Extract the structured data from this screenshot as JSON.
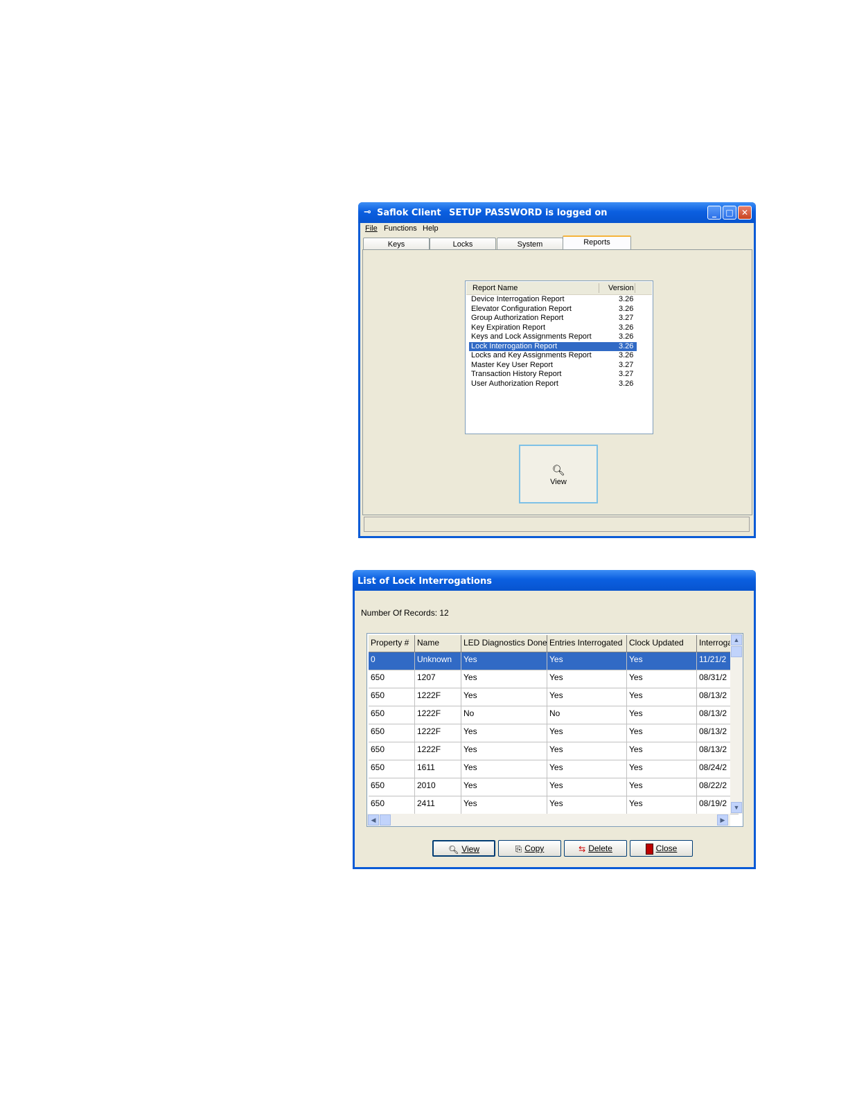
{
  "main_window": {
    "app_title": "Saflok Client",
    "login_status": "SETUP PASSWORD is logged on",
    "menu": [
      "File",
      "Functions",
      "Help"
    ],
    "tabs": [
      "Keys",
      "Locks",
      "System",
      "Reports"
    ],
    "active_tab": "Reports",
    "report_list": {
      "columns": [
        "Report Name",
        "Version"
      ],
      "rows": [
        {
          "name": "Device Interrogation Report",
          "version": "3.26"
        },
        {
          "name": "Elevator Configuration Report",
          "version": "3.26"
        },
        {
          "name": "Group Authorization Report",
          "version": "3.27"
        },
        {
          "name": "Key Expiration Report",
          "version": "3.26"
        },
        {
          "name": "Keys and Lock Assignments Report",
          "version": "3.26"
        },
        {
          "name": "Lock Interrogation Report",
          "version": "3.26",
          "selected": true
        },
        {
          "name": "Locks and Key Assignments Report",
          "version": "3.26"
        },
        {
          "name": "Master Key User Report",
          "version": "3.27"
        },
        {
          "name": "Transaction History Report",
          "version": "3.27"
        },
        {
          "name": "User Authorization Report",
          "version": "3.26"
        }
      ]
    },
    "view_button": "View"
  },
  "dialog": {
    "title": "List of Lock Interrogations",
    "record_count": "Number Of Records: 12",
    "columns": [
      "Property #",
      "Name",
      "LED Diagnostics Done",
      "Entries Interrogated",
      "Clock Updated",
      "Interroga"
    ],
    "rows": [
      [
        "0",
        "Unknown",
        "Yes",
        "Yes",
        "Yes",
        "11/21/2"
      ],
      [
        "650",
        "1207",
        "Yes",
        "Yes",
        "Yes",
        "08/31/2"
      ],
      [
        "650",
        "1222F",
        "Yes",
        "Yes",
        "Yes",
        "08/13/2"
      ],
      [
        "650",
        "1222F",
        "No",
        "No",
        "Yes",
        "08/13/2"
      ],
      [
        "650",
        "1222F",
        "Yes",
        "Yes",
        "Yes",
        "08/13/2"
      ],
      [
        "650",
        "1222F",
        "Yes",
        "Yes",
        "Yes",
        "08/13/2"
      ],
      [
        "650",
        "1611",
        "Yes",
        "Yes",
        "Yes",
        "08/24/2"
      ],
      [
        "650",
        "2010",
        "Yes",
        "Yes",
        "Yes",
        "08/22/2"
      ],
      [
        "650",
        "2411",
        "Yes",
        "Yes",
        "Yes",
        "08/19/2"
      ]
    ],
    "buttons": [
      "View",
      "Copy",
      "Delete",
      "Close"
    ]
  },
  "colors": {
    "title_bar": "#0b5fe0",
    "window_face": "#ece9d8",
    "selection": "#316ac5",
    "active_tab_accent": "#f5b33a"
  }
}
